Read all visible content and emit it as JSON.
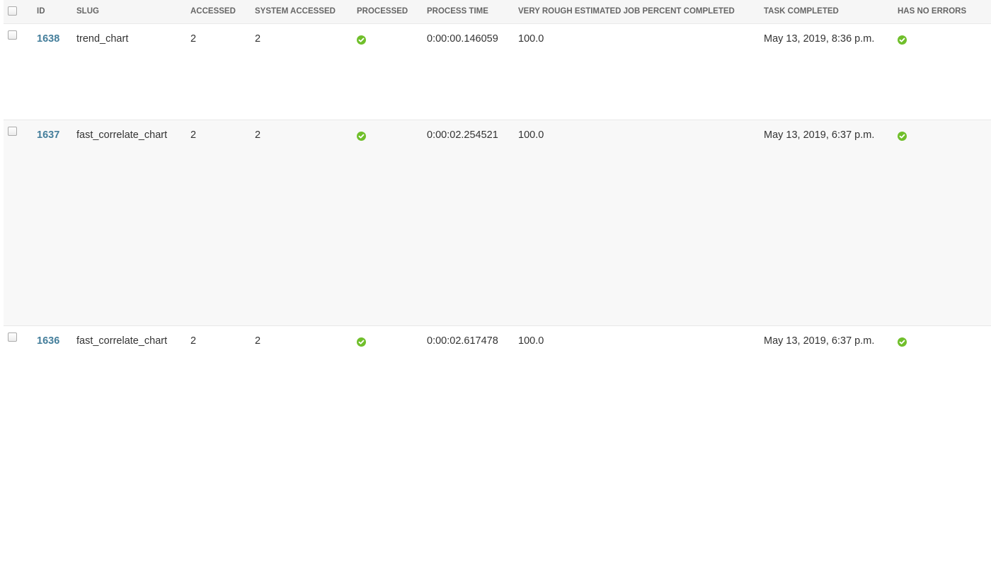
{
  "colors": {
    "link": "#447e9b",
    "success": "#70bf2b",
    "header_bg": "#f6f6f6",
    "header_text": "#666666"
  },
  "table": {
    "headers": [
      "ID",
      "SLUG",
      "ACCESSED",
      "SYSTEM ACCESSED",
      "PROCESSED",
      "PROCESS TIME",
      "VERY ROUGH ESTIMATED JOB PERCENT COMPLETED",
      "TASK COMPLETED",
      "HAS NO ERRORS"
    ],
    "rows": [
      {
        "id": "1638",
        "slug": "trend_chart",
        "accessed": "2",
        "system_accessed": "2",
        "processed_icon": "check-circle-icon",
        "process_time": "0:00:00.146059",
        "percent_completed": "100.0",
        "task_completed": "May 13, 2019, 8:36 p.m.",
        "has_no_errors_icon": "check-circle-icon"
      },
      {
        "id": "1637",
        "slug": "fast_correlate_chart",
        "accessed": "2",
        "system_accessed": "2",
        "processed_icon": "check-circle-icon",
        "process_time": "0:00:02.254521",
        "percent_completed": "100.0",
        "task_completed": "May 13, 2019, 6:37 p.m.",
        "has_no_errors_icon": "check-circle-icon"
      },
      {
        "id": "1636",
        "slug": "fast_correlate_chart",
        "accessed": "2",
        "system_accessed": "2",
        "processed_icon": "check-circle-icon",
        "process_time": "0:00:02.617478",
        "percent_completed": "100.0",
        "task_completed": "May 13, 2019, 6:37 p.m.",
        "has_no_errors_icon": "check-circle-icon"
      }
    ]
  }
}
